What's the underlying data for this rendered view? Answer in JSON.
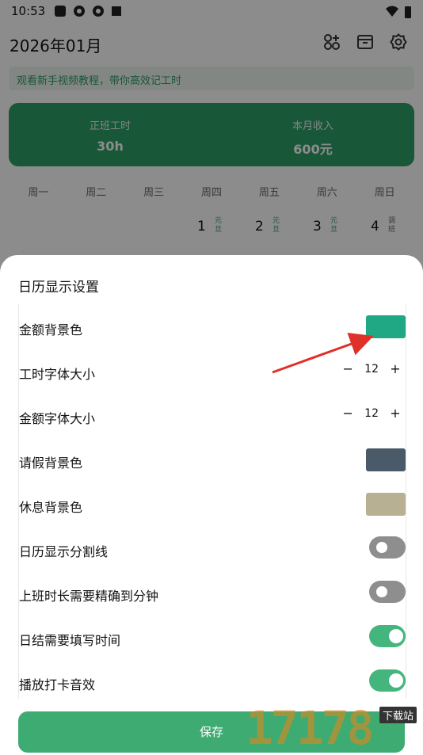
{
  "status_bar": {
    "time": "10:53"
  },
  "header": {
    "month": "2026年01月"
  },
  "tutorial": {
    "text": "观看新手视频教程，带你高效记工时"
  },
  "summary": {
    "regular_hours_label": "正班工时",
    "regular_hours_value": "30h",
    "income_label": "本月收入",
    "income_value": "600元"
  },
  "weekdays": [
    "周一",
    "周二",
    "周三",
    "周四",
    "周五",
    "周六",
    "周日"
  ],
  "dates": [
    {
      "day": "1",
      "tag": "元旦"
    },
    {
      "day": "2",
      "tag": "元旦"
    },
    {
      "day": "3",
      "tag": "元旦"
    },
    {
      "day": "4",
      "tag": "调班"
    }
  ],
  "sheet": {
    "title": "日历显示设置",
    "settings": [
      {
        "label": "金额背景色",
        "type": "color",
        "color": "#1fa883"
      },
      {
        "label": "工时字体大小",
        "type": "stepper",
        "value": "12",
        "minus": "−",
        "plus": "+"
      },
      {
        "label": "金额字体大小",
        "type": "stepper",
        "value": "12",
        "minus": "−",
        "plus": "+"
      },
      {
        "label": "请假背景色",
        "type": "color",
        "color": "#4a5a69"
      },
      {
        "label": "休息背景色",
        "type": "color",
        "color": "#b8b092"
      },
      {
        "label": "日历显示分割线",
        "type": "toggle",
        "on": false
      },
      {
        "label": "上班时长需要精确到分钟",
        "type": "toggle",
        "on": false
      },
      {
        "label": "日结需要填写时间",
        "type": "toggle",
        "on": true
      },
      {
        "label": "播放打卡音效",
        "type": "toggle",
        "on": true
      }
    ],
    "save_label": "保存"
  },
  "watermark": {
    "text": "17178",
    "badge": "下载站"
  }
}
